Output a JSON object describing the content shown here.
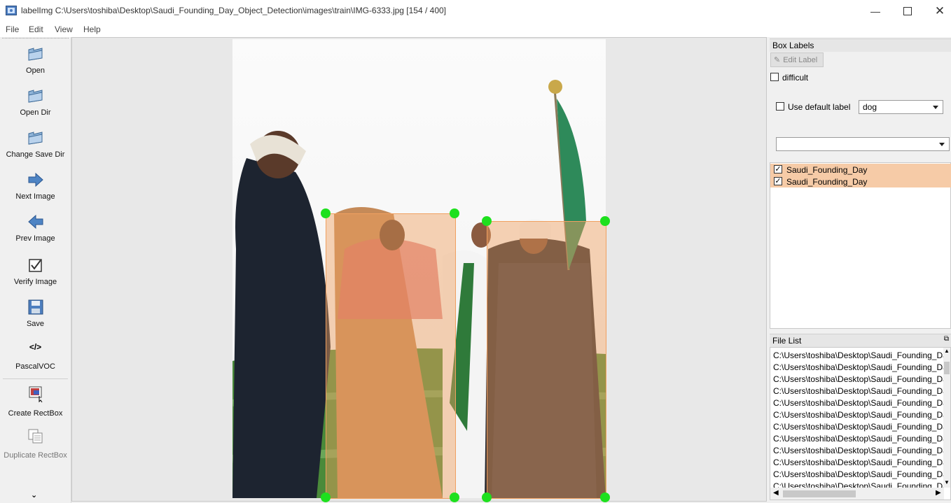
{
  "window": {
    "title": "labelImg C:\\Users\\toshiba\\Desktop\\Saudi_Founding_Day_Object_Detection\\images\\train\\IMG-6333.jpg [154 / 400]",
    "minimize_icon": "minimize-icon",
    "maximize_icon": "maximize-icon",
    "close_icon": "close-icon"
  },
  "menu": [
    "File",
    "Edit",
    "View",
    "Help"
  ],
  "toolbar": {
    "open": "Open",
    "open_dir": "Open Dir",
    "change_save_dir": "Change Save Dir",
    "next_image": "Next Image",
    "prev_image": "Prev Image",
    "verify_image": "Verify Image",
    "save": "Save",
    "format_icon_text": "</>",
    "format": "PascalVOC",
    "create_rectbox": "Create RectBox",
    "duplicate_rectbox": "Duplicate RectBox",
    "more_icon": "double-chevron-down-icon"
  },
  "canvas": {
    "box_color": "#f0a060",
    "handle_color": "#1ee01e",
    "image_description": "photo"
  },
  "box_labels": {
    "title": "Box Labels",
    "edit_label_button": "Edit Label",
    "difficult": "difficult",
    "use_default_label": "Use default label",
    "default_label_value": "dog",
    "items": [
      {
        "label": "Saudi_Founding_Day",
        "checked": true
      },
      {
        "label": "Saudi_Founding_Day",
        "checked": true
      }
    ]
  },
  "file_list": {
    "title": "File List",
    "items": [
      "C:\\Users\\toshiba\\Desktop\\Saudi_Founding_Da",
      "C:\\Users\\toshiba\\Desktop\\Saudi_Founding_Da",
      "C:\\Users\\toshiba\\Desktop\\Saudi_Founding_Da",
      "C:\\Users\\toshiba\\Desktop\\Saudi_Founding_Da",
      "C:\\Users\\toshiba\\Desktop\\Saudi_Founding_Da",
      "C:\\Users\\toshiba\\Desktop\\Saudi_Founding_Da",
      "C:\\Users\\toshiba\\Desktop\\Saudi_Founding_Da",
      "C:\\Users\\toshiba\\Desktop\\Saudi_Founding_Da",
      "C:\\Users\\toshiba\\Desktop\\Saudi_Founding_Da",
      "C:\\Users\\toshiba\\Desktop\\Saudi_Founding_Da",
      "C:\\Users\\toshiba\\Desktop\\Saudi_Founding_Da",
      "C:\\Users\\toshiba\\Desktop\\Saudi_Founding_Da"
    ]
  }
}
